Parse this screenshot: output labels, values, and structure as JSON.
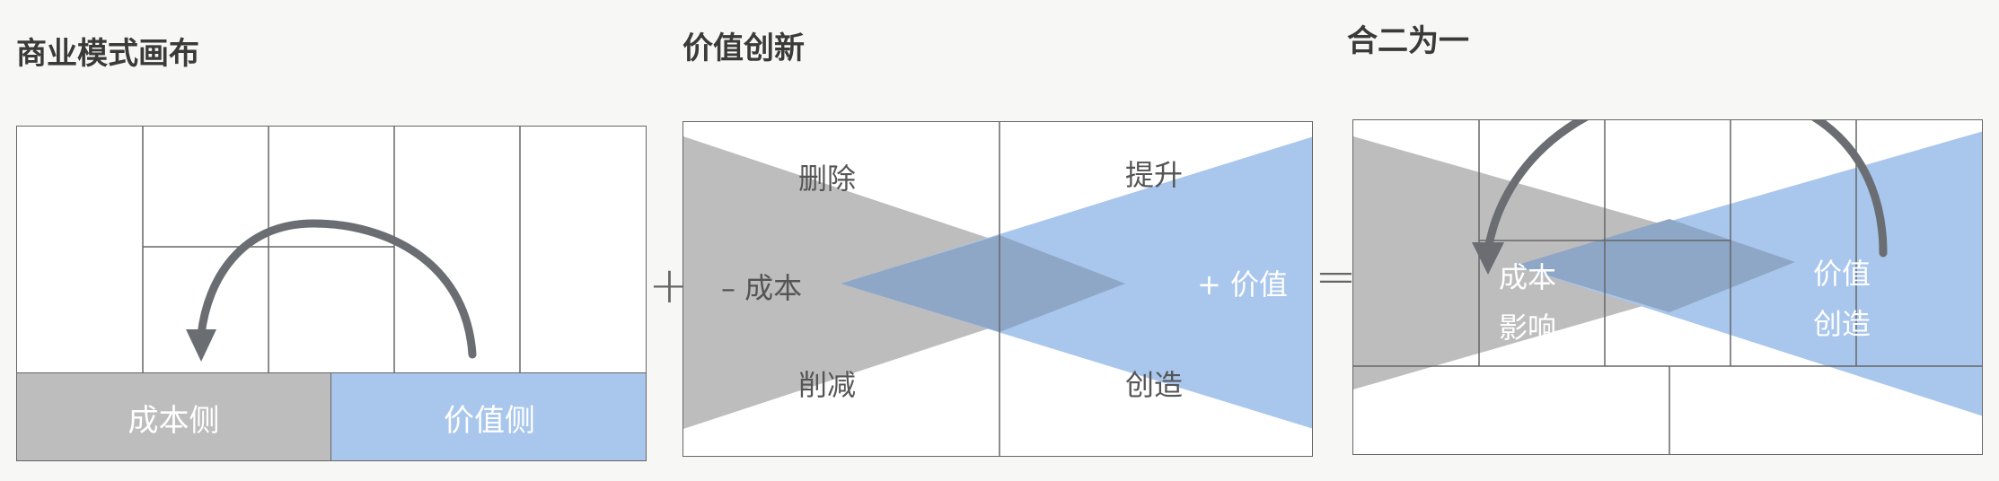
{
  "titles": {
    "canvas": "商业模式画布",
    "innovation": "价值创新",
    "combined": "合二为一"
  },
  "canvas_panel": {
    "cost_side": "成本侧",
    "value_side": "价值侧"
  },
  "innovation_panel": {
    "eliminate": "删除",
    "raise": "提升",
    "reduce": "削减",
    "create": "创造",
    "minus_cost": "– 成本",
    "plus_value": "+ 价值"
  },
  "operators": {
    "plus": "+",
    "equals": "="
  },
  "combined_panel": {
    "cost_line1": "成本",
    "cost_line2": "影响",
    "value_line1": "价值",
    "value_line2": "创造"
  },
  "colors": {
    "grey": "#bdbdbd",
    "blue": "#a9c6ec",
    "overlap": "#8ea7c6",
    "arrow": "#6a6e72",
    "grid": "#666666"
  }
}
